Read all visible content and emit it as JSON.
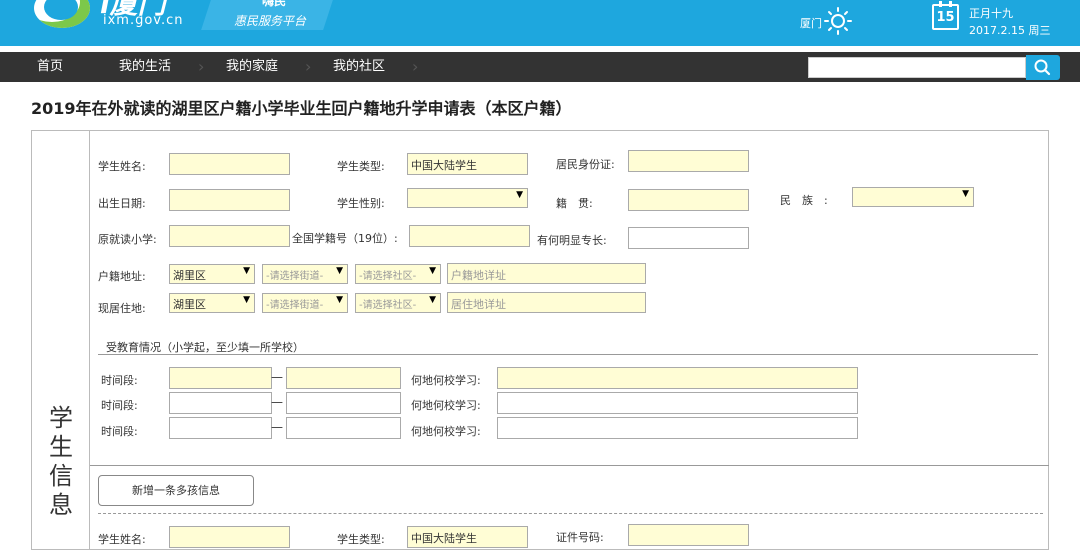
{
  "header": {
    "site_name": "i厦门",
    "site_url": "ixm.gov.cn",
    "slogan_top": "嗨民",
    "slogan": "惠民服务平台",
    "weather_city": "厦门",
    "weather_icon": "sun-icon",
    "calendar_day": "15",
    "lunar_date": "正月十九",
    "date": "2017.2.15 周三"
  },
  "nav": {
    "items": [
      "首页",
      "我的生活",
      "我的家庭",
      "我的社区"
    ],
    "search_placeholder": "",
    "search_icon": "search-icon"
  },
  "page": {
    "title": "2019年在外就读的湖里区户籍小学毕业生回户籍地升学申请表（本区户籍）",
    "section_label": "学生信息"
  },
  "form": {
    "student_name_label": "学生姓名:",
    "student_type_label": "学生类型:",
    "student_type_value": "中国大陆学生",
    "id_card_label": "居民身份证:",
    "birth_date_label": "出生日期:",
    "gender_label": "学生性别:",
    "native_place_label": "籍　贯:",
    "ethnicity_label": "民　族　:",
    "orig_school_label": "原就读小学:",
    "student_no_label": "全国学籍号（19位）:",
    "specialty_label": "有何明显专长:",
    "household_addr_label": "户籍地址:",
    "household_district": "湖里区",
    "street_placeholder": "-请选择街道-",
    "community_placeholder": "-请选择社区-",
    "household_detail_placeholder": "户籍地详址",
    "residence_label": "现居住地:",
    "residence_district": "湖里区",
    "residence_detail_placeholder": "居住地详址",
    "edu_title": "受教育情况（小学起，至少填一所学校）",
    "period_label": "时间段:",
    "period_sep": "—",
    "school_label": "何地何校学习:",
    "add_child_button": "新增一条多孩信息",
    "next_student_name_label": "学生姓名:",
    "next_student_type_label": "学生类型:",
    "next_student_type_value": "中国大陆学生",
    "next_id_label": "证件号码:"
  }
}
